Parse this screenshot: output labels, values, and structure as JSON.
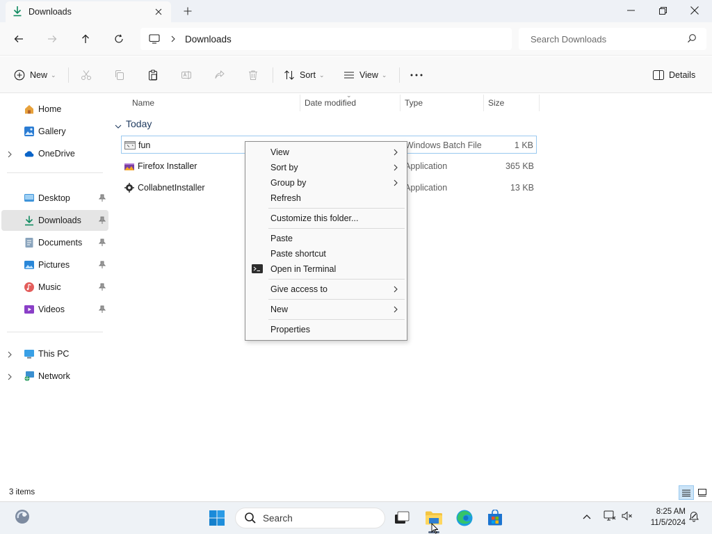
{
  "window": {
    "tab_title": "Downloads"
  },
  "address": {
    "crumb": "Downloads",
    "search_placeholder": "Search Downloads"
  },
  "toolbar": {
    "new_label": "New",
    "sort_label": "Sort",
    "view_label": "View",
    "details_label": "Details"
  },
  "sidebar": {
    "items": [
      {
        "label": "Home",
        "icon": "home-icon"
      },
      {
        "label": "Gallery",
        "icon": "gallery-icon"
      },
      {
        "label": "OneDrive",
        "icon": "onedrive-icon"
      },
      {
        "label": "Desktop",
        "icon": "desktop-icon"
      },
      {
        "label": "Downloads",
        "icon": "downloads-icon"
      },
      {
        "label": "Documents",
        "icon": "documents-icon"
      },
      {
        "label": "Pictures",
        "icon": "pictures-icon"
      },
      {
        "label": "Music",
        "icon": "music-icon"
      },
      {
        "label": "Videos",
        "icon": "videos-icon"
      },
      {
        "label": "This PC",
        "icon": "this-pc-icon"
      },
      {
        "label": "Network",
        "icon": "network-icon"
      }
    ]
  },
  "columns": {
    "name": "Name",
    "date": "Date modified",
    "type": "Type",
    "size": "Size"
  },
  "group": {
    "name": "Today"
  },
  "files": [
    {
      "name": "fun",
      "type": "Windows Batch File",
      "size": "1 KB"
    },
    {
      "name": "Firefox Installer",
      "type": "Application",
      "size": "365 KB"
    },
    {
      "name": "CollabnetInstaller",
      "type": "Application",
      "size": "13 KB"
    }
  ],
  "context_menu": {
    "items": {
      "view": "View",
      "sort_by": "Sort by",
      "group_by": "Group by",
      "refresh": "Refresh",
      "customize": "Customize this folder...",
      "paste": "Paste",
      "paste_shortcut": "Paste shortcut",
      "open_terminal": "Open in Terminal",
      "give_access": "Give access to",
      "new": "New",
      "properties": "Properties"
    }
  },
  "status": {
    "item_count": "3 items"
  },
  "taskbar": {
    "search_label": "Search",
    "time": "8:25 AM",
    "date": "11/5/2024"
  },
  "colors": {
    "accent": "#0067c0",
    "selection_border": "#99c9ef",
    "sidebar_selected": "#e5e5e5",
    "taskbar_bg": "#eef2f6"
  }
}
